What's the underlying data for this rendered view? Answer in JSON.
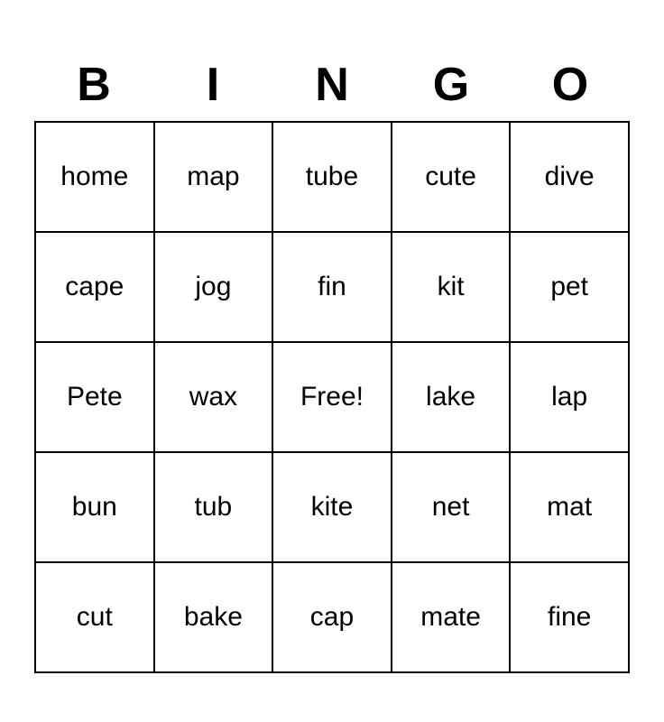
{
  "header": {
    "letters": [
      "B",
      "I",
      "N",
      "G",
      "O"
    ]
  },
  "grid": {
    "rows": [
      [
        "home",
        "map",
        "tube",
        "cute",
        "dive"
      ],
      [
        "cape",
        "jog",
        "fin",
        "kit",
        "pet"
      ],
      [
        "Pete",
        "wax",
        "Free!",
        "lake",
        "lap"
      ],
      [
        "bun",
        "tub",
        "kite",
        "net",
        "mat"
      ],
      [
        "cut",
        "bake",
        "cap",
        "mate",
        "fine"
      ]
    ]
  }
}
